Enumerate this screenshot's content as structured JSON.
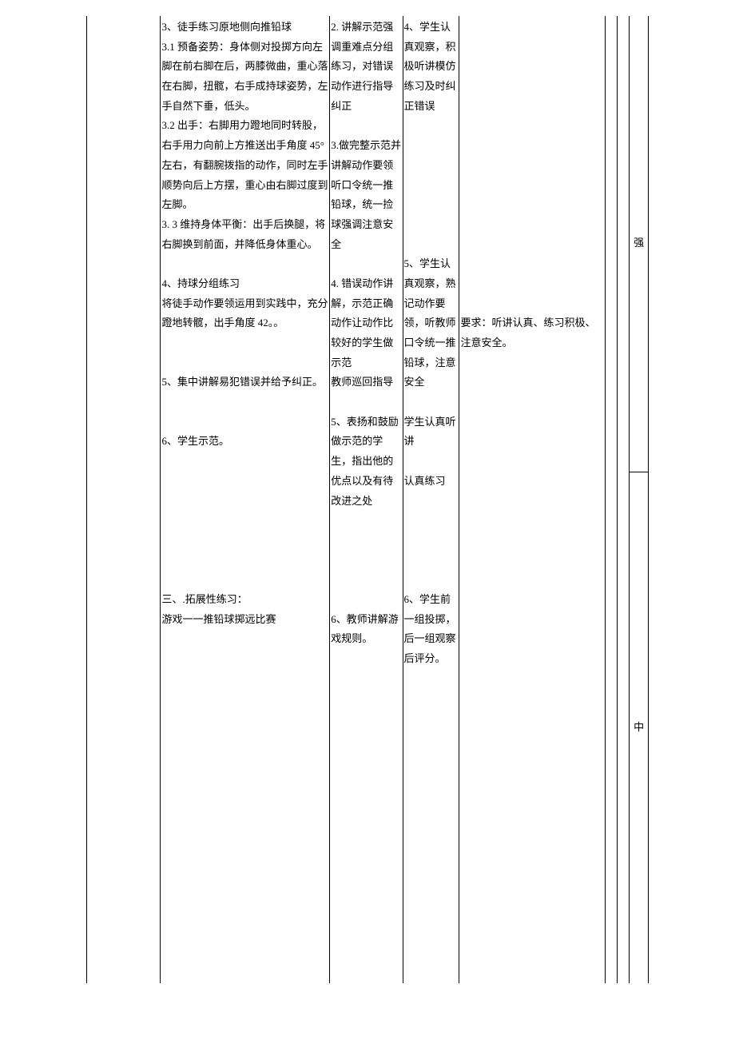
{
  "colB": "3、徒手练习原地侧向推铅球\n3.1 预备姿势：身体侧对投掷方向左脚在前右脚在后，两膝微曲，重心落在右脚，扭髋，右手成持球姿势，左手自然下垂，低头。\n3.2 出手：右脚用力蹬地同时转股，右手用力向前上方推送出手角度 45°左右，有翻腕拨指的动作，同时左手顺势向后上方摆，重心由右脚过度到左脚。\n3. 3 维持身体平衡：出手后换腿，将右脚换到前面，并降低身体重心。\n\n4、持球分组练习\n将徒手动作要领运用到实践中，充分蹬地转髋，出手角度 42。。\n\n\n5、集中讲解易犯错误并给予纠正。\n\n\n6、学生示范。\n\n\n\n\n\n\n\n三、.拓展性练习：\n游戏一一推铅球掷远比赛",
  "colC": "2. 讲解示范强调重难点分组练习，对错误动作进行指导纠正\n\n3.做完整示范并讲解动作要领听口令统一推铅球，统一捡球强调注意安全\n\n4. 错误动作讲解，示范正确动作让动作比较好的学生做示范\n教师巡回指导\n\n5、表扬和鼓励做示范的学生，指出他的优点以及有待改进之处\n\n\n\n\n\n6、教师讲解游戏规则。",
  "colD": "4、学生认真观察，积极听讲模仿练习及时纠正错误\n\n\n\n\n\n\n\n5、学生认真观察，熟记动作要领，听教师口令统一推铅球，注意安全\n\n学生认真听讲\n\n认真练习\n\n\n\n\n\n6、学生前一组投掷，后一组观察后评分。",
  "colE": "\n\n\n\n\n\n\n\n\n\n\n\n\n\n\n要求：听讲认真、练习积极、注意安全。",
  "rightTop": "强",
  "rightBottom": "中"
}
